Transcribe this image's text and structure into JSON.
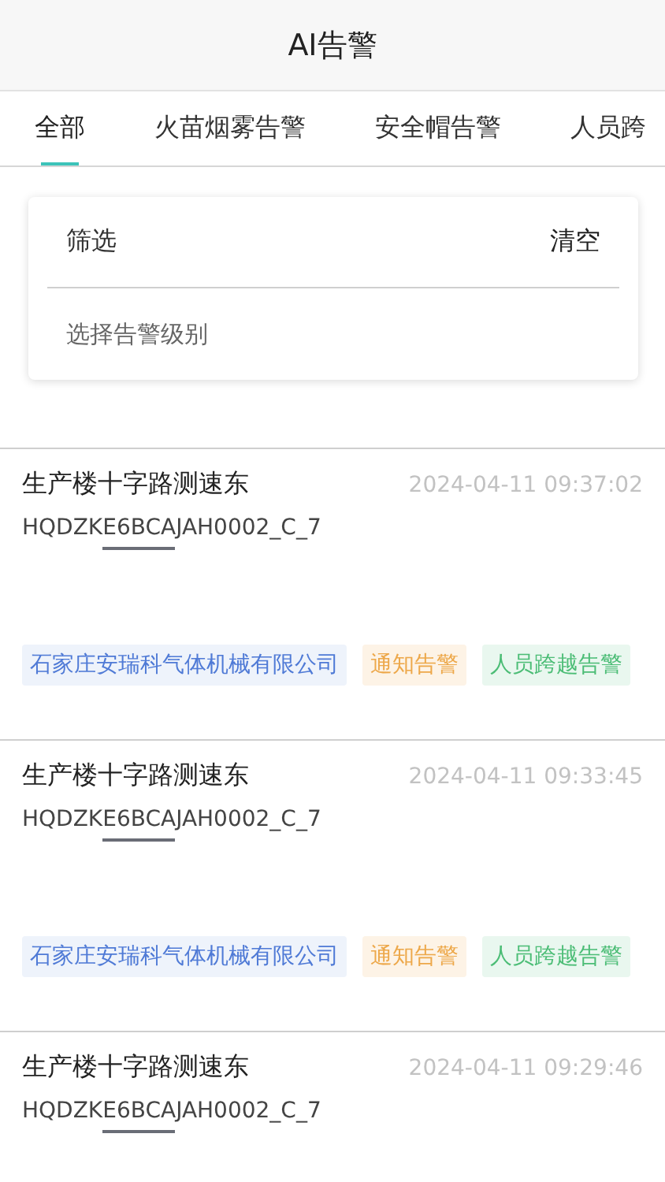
{
  "header": {
    "title": "AI告警"
  },
  "tabs": [
    {
      "label": "全部",
      "selected": true
    },
    {
      "label": "火苗烟雾告警",
      "selected": false
    },
    {
      "label": "安全帽告警",
      "selected": false
    },
    {
      "label": "人员跨",
      "selected": false
    }
  ],
  "filter": {
    "title": "筛选",
    "clear": "清空",
    "placeholder": "选择告警级别"
  },
  "alerts": [
    {
      "location": "生产楼十字路测速东",
      "time": "2024-04-11 09:37:02",
      "device": "HQDZKE6BCAJAH0002_C_7",
      "tags": [
        {
          "text": "石家庄安瑞科气体机械有限公司",
          "kind": "company"
        },
        {
          "text": "通知告警",
          "kind": "level"
        },
        {
          "text": "人员跨越告警",
          "kind": "type"
        }
      ]
    },
    {
      "location": "生产楼十字路测速东",
      "time": "2024-04-11 09:33:45",
      "device": "HQDZKE6BCAJAH0002_C_7",
      "tags": [
        {
          "text": "石家庄安瑞科气体机械有限公司",
          "kind": "company"
        },
        {
          "text": "通知告警",
          "kind": "level"
        },
        {
          "text": "人员跨越告警",
          "kind": "type"
        }
      ]
    },
    {
      "location": "生产楼十字路测速东",
      "time": "2024-04-11 09:29:46",
      "device": "HQDZKE6BCAJAH0002_C_7"
    }
  ]
}
